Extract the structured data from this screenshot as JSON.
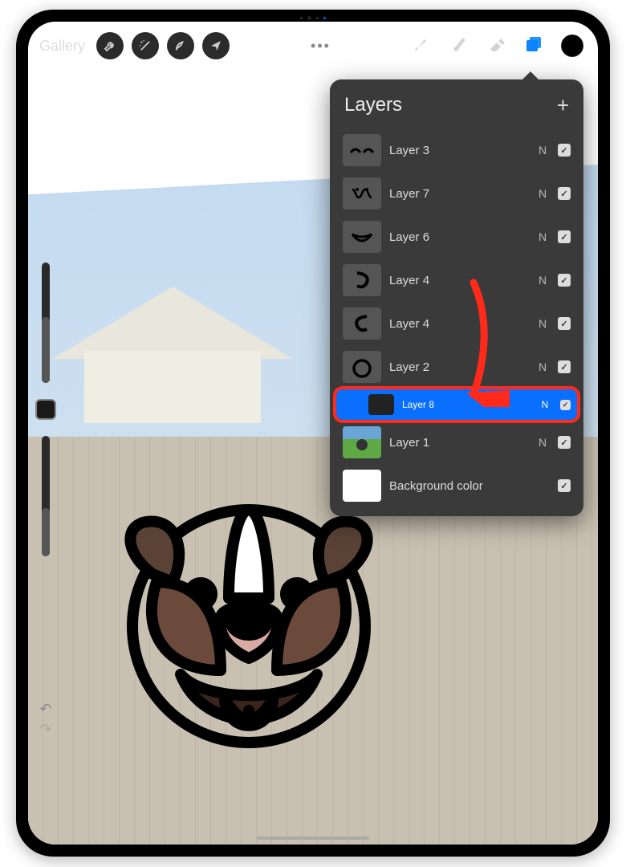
{
  "toolbar": {
    "gallery_label": "Gallery",
    "ellipsis": "•••"
  },
  "layers_panel": {
    "title": "Layers",
    "add_label": "+",
    "blend_normal": "N",
    "items": [
      {
        "name": "Layer 3",
        "blend": "N",
        "visible": true,
        "thumb": "stroke-arcs"
      },
      {
        "name": "Layer 7",
        "blend": "N",
        "visible": true,
        "thumb": "stroke-scribble"
      },
      {
        "name": "Layer 6",
        "blend": "N",
        "visible": true,
        "thumb": "stroke-mouth"
      },
      {
        "name": "Layer 4",
        "blend": "N",
        "visible": true,
        "thumb": "stroke-ear-r"
      },
      {
        "name": "Layer 4",
        "blend": "N",
        "visible": true,
        "thumb": "stroke-ear-l"
      },
      {
        "name": "Layer 2",
        "blend": "N",
        "visible": true,
        "thumb": "stroke-circle"
      },
      {
        "name": "Layer 8",
        "blend": "N",
        "visible": true,
        "thumb": "dark",
        "selected": true
      },
      {
        "name": "Layer 1",
        "blend": "N",
        "visible": true,
        "thumb": "photo"
      },
      {
        "name": "Background color",
        "blend": "",
        "visible": true,
        "thumb": "bg"
      }
    ]
  },
  "annotation": {
    "arrow_color": "#ff2a1a",
    "highlight_color": "#ff2a1a"
  },
  "colors": {
    "accent": "#0a84ff",
    "panel_bg": "#3a3a3a"
  }
}
